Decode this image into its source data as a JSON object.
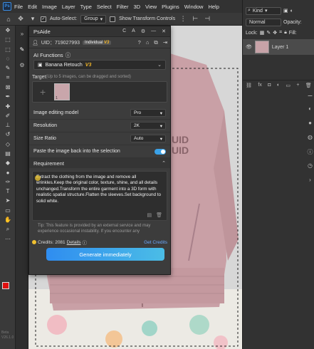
{
  "menubar": {
    "app": "Ps",
    "items": [
      "File",
      "Edit",
      "Image",
      "Layer",
      "Type",
      "Select",
      "Filter",
      "3D",
      "View",
      "Plugins",
      "Window",
      "Help"
    ]
  },
  "options": {
    "auto_select_label": "Auto-Select:",
    "auto_select_value": "Group",
    "show_transform_label": "Show Transform Controls"
  },
  "layers": {
    "kind_label": "Kind",
    "blend_mode": "Normal",
    "opacity_label": "Opacity:",
    "lock_label": "Lock:",
    "fill_label": "Fill:",
    "layer_name": "Layer 1"
  },
  "plugin": {
    "title": "PsAide",
    "title_controls": [
      "C",
      "A",
      "⬛",
      "—",
      "✕"
    ],
    "uid": "UID：719027993",
    "tier": "Individual",
    "tier_version": "V3",
    "ai_functions_label": "AI Functions",
    "function_name": "Banana Retouch",
    "function_version": "V3",
    "target_label": "Target",
    "target_hint": "(Up to 5 images, can be dragged and sorted)",
    "target_index": "1",
    "editing_model_label": "Image editing model",
    "editing_model_value": "Pro",
    "resolution_label": "Resolution",
    "resolution_value": "2K",
    "size_ratio_label": "Size Ratio",
    "size_ratio_value": "Auto",
    "paste_back_label": "Paste the image back into the selection",
    "requirement_label": "Requirement",
    "requirement_text": "Extract the clothing from the image and remove all wrinkles.Keep the original color, texture, shine, and all details unchanged.Transform the entire garment into a 3D form with realistic spatial structure.Flatten the sleeves.Set background to solid white.",
    "tip": "Tip: This feature is provided by an external service and may experience occasional instability. If you encounter any",
    "credits_label": "Credits: 2081",
    "details_label": "Details",
    "get_credits_label": "Get Credits",
    "generate_label": "Generate immediately"
  },
  "toolbar": {
    "version_line1": "Beta",
    "version_line2": "V26.1.0"
  },
  "colors": {
    "accent": "#3ba2e8",
    "foreground": "#e01010",
    "background": "#000000",
    "version_badge": "#f0b429",
    "jacket": "#c9a0a6"
  }
}
